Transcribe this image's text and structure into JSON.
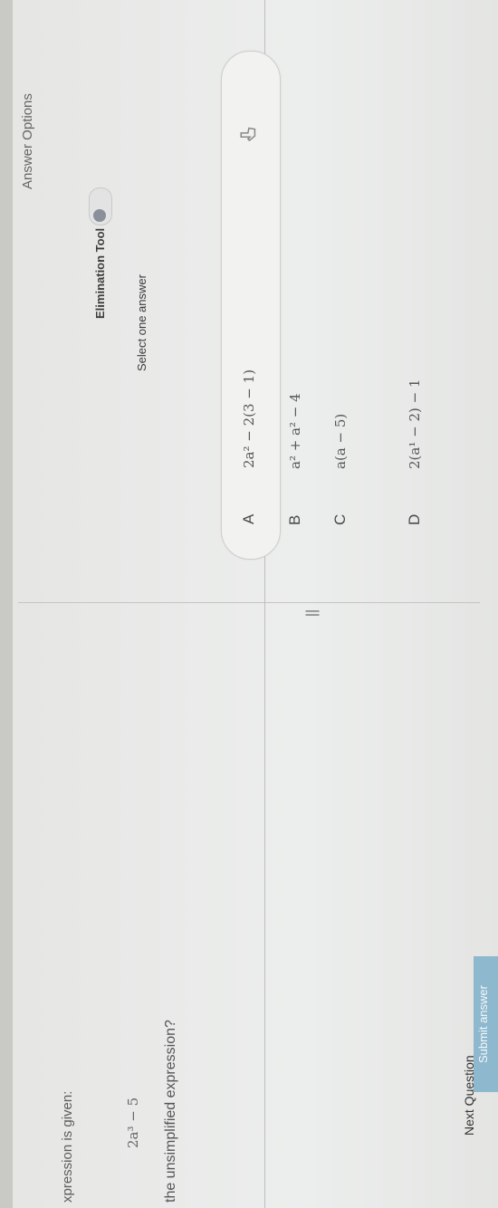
{
  "question": {
    "intro": "xpression is given:",
    "expression": "2a³ − 5",
    "prompt": "the unsimplified expression?"
  },
  "answer_panel": {
    "title": "Answer Options",
    "elimination_tool_label": "Elimination Tool",
    "select_label": "Select one answer",
    "options": [
      {
        "letter": "A",
        "expr": "2a² − 2(3 − 1)"
      },
      {
        "letter": "B",
        "expr": "a² + a² − 4"
      },
      {
        "letter": "C",
        "expr": "a(a − 5)"
      },
      {
        "letter": "D",
        "expr": "2(a¹ − 2) − 1"
      }
    ],
    "selected_index": 0,
    "pane_handle": "||"
  },
  "footer": {
    "next_label": "Next Question",
    "submit_label": "Submit answer"
  },
  "colors": {
    "submit_button": "#8eb8ce",
    "toggle_knob": "#8a8f99",
    "background": "#eceeed"
  }
}
